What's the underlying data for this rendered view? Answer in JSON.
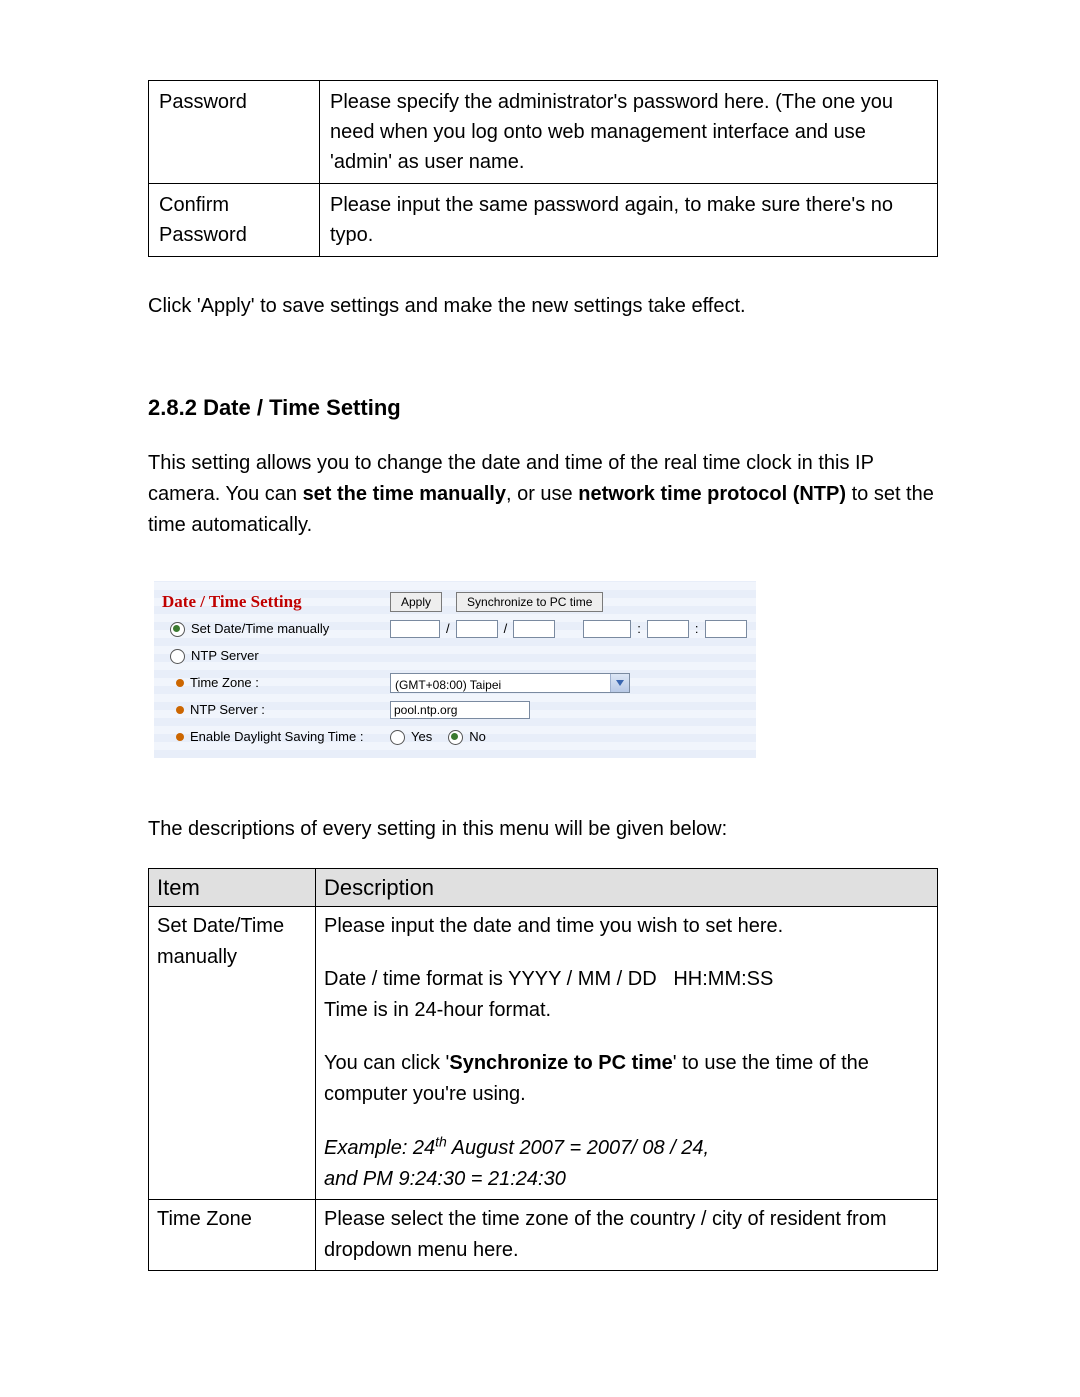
{
  "table1": {
    "row1_label": "Password",
    "row1_text": "Please specify the administrator's password here. (The one you need when you log onto web management interface and use 'admin' as user name.",
    "row2_label": "Confirm Password",
    "row2_text": "Please input the same password again, to make sure there's no typo."
  },
  "apply_sentence": "Click 'Apply' to save settings and make the new settings take effect.",
  "section_number": "2.8.2",
  "section_title": "Date / Time Setting",
  "intro_pre": "This setting allows you to change the date and time of the real time clock in this IP camera. You can ",
  "intro_bold1": "set the time manually",
  "intro_mid": ", or use ",
  "intro_bold2": "network time protocol (NTP)",
  "intro_post": " to set the time automatically.",
  "panel": {
    "title": "Date / Time Setting",
    "apply_btn": "Apply",
    "sync_btn": "Synchronize to PC time",
    "manual_label": "Set Date/Time manually",
    "ntp_server_radio": "NTP Server",
    "time_zone_label": "Time Zone :",
    "ntp_server_label": "NTP Server :",
    "dst_label": "Enable Daylight Saving Time :",
    "tz_value": "(GMT+08:00) Taipei",
    "ntp_value": "pool.ntp.org",
    "yes": "Yes",
    "no": "No",
    "slash": "/",
    "colon": ":"
  },
  "lead2": "The descriptions of every setting in this menu will be given below:",
  "table2": {
    "h1": "Item",
    "h2": "Description",
    "r1_label": "Set Date/Time manually",
    "r1_l1": "Please input the date and time you wish to set here.",
    "r1_l2": "Date / time format is YYYY / MM / DD   HH:MM:SS",
    "r1_l3": "Time is in 24-hour format.",
    "r1_l4a": "You can click '",
    "r1_l4b": "Synchronize to PC time",
    "r1_l4c": "' to use the time of the computer you're using.",
    "r1_ex1a": "Example: 24",
    "r1_ex1b": "th",
    "r1_ex1c": " August 2007 = 2007/ 08 / 24,",
    "r1_ex2": "and PM 9:24:30 = 21:24:30",
    "r2_label": "Time Zone",
    "r2_text": "Please select the time zone of the country / city of resident from dropdown menu here."
  }
}
